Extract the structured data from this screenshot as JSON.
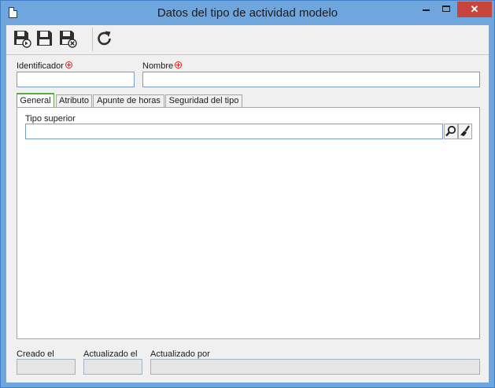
{
  "window": {
    "title": "Datos del tipo de actividad modelo",
    "close_glyph": "✕"
  },
  "toolbar": {
    "buttons": [
      {
        "name": "save-and-new-icon",
        "tooltip": ""
      },
      {
        "name": "save-icon",
        "tooltip": ""
      },
      {
        "name": "save-and-close-icon",
        "tooltip": ""
      },
      {
        "name": "refresh-icon",
        "tooltip": ""
      }
    ]
  },
  "form": {
    "identificador_label": "Identificador",
    "identificador_value": "",
    "nombre_label": "Nombre",
    "nombre_value": ""
  },
  "tabs": [
    {
      "label": "General",
      "active": true
    },
    {
      "label": "Atributo",
      "active": false
    },
    {
      "label": "Apunte de horas",
      "active": false
    },
    {
      "label": "Seguridad del tipo",
      "active": false
    }
  ],
  "general": {
    "tipo_superior_label": "Tipo superior",
    "tipo_superior_value": ""
  },
  "footer": {
    "creado_label": "Creado el",
    "creado_value": "",
    "actualizado_label": "Actualizado el",
    "actualizado_value": "",
    "actualizado_por_label": "Actualizado por",
    "actualizado_por_value": ""
  },
  "colors": {
    "title_bar": "#6fa6dd",
    "close_button": "#c7453a",
    "active_tab_accent": "#58a943",
    "required_marker": "#e02020"
  }
}
